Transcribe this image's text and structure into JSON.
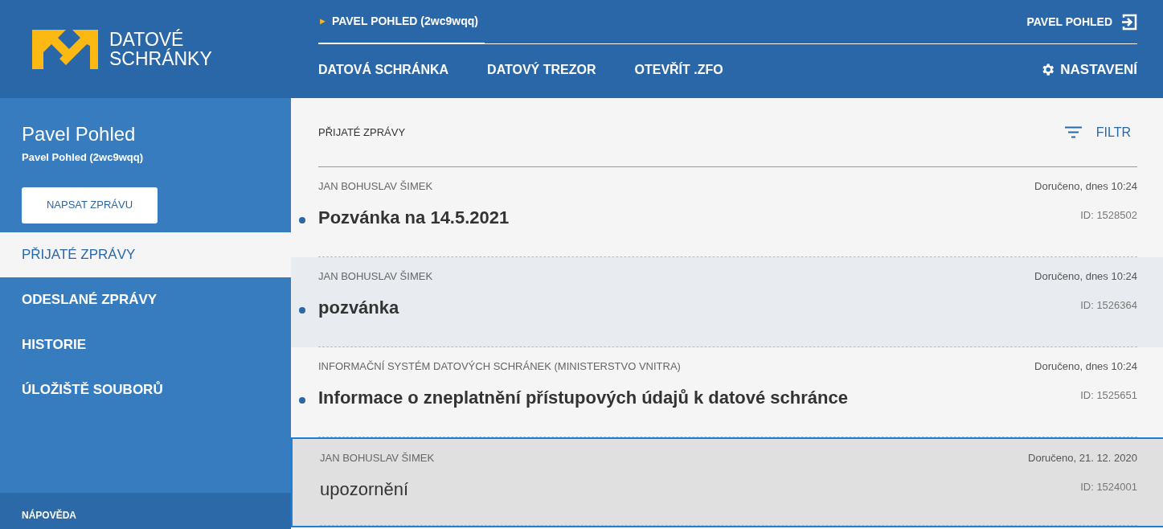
{
  "logo": {
    "line_1": "DATOVÉ",
    "line_2": "SCHRÁNKY"
  },
  "header": {
    "account_marker": "►",
    "account": "PAVEL POHLED (2wc9wqq)",
    "user": "PAVEL POHLED",
    "settings": "NASTAVENÍ",
    "tabs": [
      {
        "label": "DATOVÁ SCHRÁNKA",
        "selected": false
      },
      {
        "label": "DATOVÝ TREZOR",
        "selected": false
      },
      {
        "label": "OTEVŘÍT .ZFO",
        "selected": false
      }
    ]
  },
  "sidebar": {
    "name": "Pavel Pohled",
    "box": "Pavel Pohled (2wc9wqq)",
    "compose_button": "NAPSAT ZPRÁVU",
    "items": [
      {
        "label": "PŘIJATÉ ZPRÁVY",
        "selected": true
      },
      {
        "label": "ODESLANÉ ZPRÁVY",
        "selected": false
      },
      {
        "label": "HISTORIE",
        "selected": false
      },
      {
        "label": "ÚLOŽIŠTĚ SOUBORŮ",
        "selected": false
      }
    ],
    "footer": "NÁPOVĚDA"
  },
  "main": {
    "title": "PŘIJATÉ ZPRÁVY",
    "filter": "FILTR",
    "messages": [
      {
        "sender": "JAN BOHUSLAV ŠIMEK",
        "subject": "Pozvánka na 14.5.2021",
        "delivered": "Doručeno, dnes 10:24",
        "id": "ID: 1528502",
        "unread": true,
        "hovered": false,
        "selected": false
      },
      {
        "sender": "JAN BOHUSLAV ŠIMEK",
        "subject": "pozvánka",
        "delivered": "Doručeno, dnes 10:24",
        "id": "ID: 1526364",
        "unread": true,
        "hovered": true,
        "selected": false
      },
      {
        "sender": "INFORMAČNÍ SYSTÉM DATOVÝCH SCHRÁNEK (MINISTERSTVO VNITRA)",
        "subject": "Informace o zneplatnění přístupových údajů k datové schránce",
        "delivered": "Doručeno, dnes 10:24",
        "id": "ID: 1525651",
        "unread": true,
        "hovered": false,
        "selected": false
      },
      {
        "sender": "JAN BOHUSLAV ŠIMEK",
        "subject": "upozornění",
        "delivered": "Doručeno, 21. 12. 2020",
        "id": "ID: 1524001",
        "unread": false,
        "hovered": false,
        "selected": true
      }
    ]
  }
}
